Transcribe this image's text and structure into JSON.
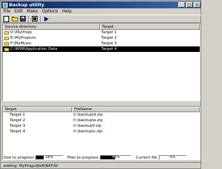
{
  "window": {
    "title": "Backup utility"
  },
  "menu": {
    "items": [
      "File",
      "Edit",
      "Make",
      "Options",
      "Help"
    ]
  },
  "top_table": {
    "headers": [
      "Source directory",
      "Target"
    ],
    "rows": [
      {
        "source": "D:\\MyProgs",
        "target": "Target 1"
      },
      {
        "source": "E:\\MyProjects",
        "target": "Target 2"
      },
      {
        "source": "F:\\MyMusic",
        "target": "Target 3"
      },
      {
        "source": "C:\\W98\\Application Data",
        "target": "Target 4"
      }
    ]
  },
  "bottom_table": {
    "headers": [
      "Target",
      "FileName"
    ],
    "rows": [
      {
        "target": "Target 1",
        "file": "h:\\backup\\d.zip"
      },
      {
        "target": "Target 2",
        "file": "h:\\backup\\e.zip"
      },
      {
        "target": "Target 3",
        "file": "h:\\backup\\f.zip"
      },
      {
        "target": "Target 4",
        "file": "h:\\backup\\c.zip"
      }
    ]
  },
  "status": {
    "size_label": "Size to progress",
    "size_progress": 0.28,
    "size_text": "28%",
    "files_label": "Files to progress",
    "files_progress": 0.48,
    "files_text": "48%",
    "current_label": "Current file",
    "current_progress": 0.0,
    "current_text": "0%"
  },
  "message": "adding: MyProgs\\BaN\\BAT\\W"
}
